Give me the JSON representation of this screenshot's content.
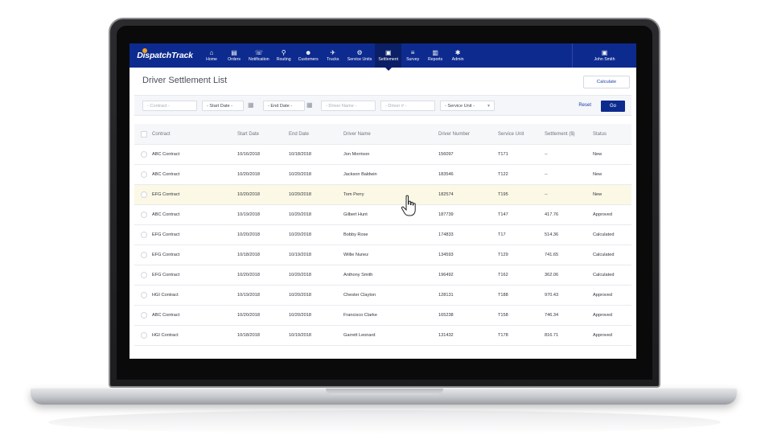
{
  "brand": {
    "name": "DispatchTrack"
  },
  "nav": {
    "items": [
      {
        "label": "Home",
        "icon": "home-icon",
        "glyph": "⌂"
      },
      {
        "label": "Orders",
        "icon": "orders-icon",
        "glyph": "▤"
      },
      {
        "label": "Notification",
        "icon": "notification-icon",
        "glyph": "☏"
      },
      {
        "label": "Routing",
        "icon": "routing-icon",
        "glyph": "⚲"
      },
      {
        "label": "Customers",
        "icon": "customers-icon",
        "glyph": "☻"
      },
      {
        "label": "Trucks",
        "icon": "trucks-icon",
        "glyph": "✈"
      },
      {
        "label": "Service Units",
        "icon": "service-units-icon",
        "glyph": "⚙"
      },
      {
        "label": "Settlement",
        "icon": "settlement-icon",
        "glyph": "▣"
      },
      {
        "label": "Survey",
        "icon": "survey-icon",
        "glyph": "≡"
      },
      {
        "label": "Reports",
        "icon": "reports-icon",
        "glyph": "▥"
      },
      {
        "label": "Admin",
        "icon": "admin-icon",
        "glyph": "✱"
      }
    ],
    "active": "Settlement"
  },
  "user": {
    "name": "John Smith",
    "icon": "user-icon"
  },
  "page": {
    "title": "Driver Settlement List",
    "calculate_label": "Calculate"
  },
  "filters": {
    "contract_placeholder": "- Contract -",
    "start_date_label": "- Start Date -",
    "end_date_label": "- End Date -",
    "driver_name_placeholder": "- Driver Name -",
    "driver_number_placeholder": "- Driver # -",
    "service_unit_label": "- Service Unit -",
    "reset_label": "Reset",
    "go_label": "Go"
  },
  "table": {
    "headers": {
      "contract": "Contract",
      "start_date": "Start Date",
      "end_date": "End Date",
      "driver_name": "Driver Name",
      "driver_number": "Driver Number",
      "service_unit": "Service Unit",
      "settlement": "Settlement ($)",
      "status": "Status"
    },
    "rows": [
      {
        "contract": "ABC Contract",
        "start": "10/16/2018",
        "end": "10/18/2018",
        "driver": "Jon Morrison",
        "number": "156097",
        "unit": "T171",
        "settlement": "--",
        "status": "New"
      },
      {
        "contract": "ABC Contract",
        "start": "10/20/2018",
        "end": "10/20/2018",
        "driver": "Jackson Baldwin",
        "number": "183546",
        "unit": "T122",
        "settlement": "--",
        "status": "New"
      },
      {
        "contract": "EFG Contract",
        "start": "10/20/2018",
        "end": "10/20/2018",
        "driver": "Tom Perry",
        "number": "182574",
        "unit": "T195",
        "settlement": "--",
        "status": "New"
      },
      {
        "contract": "ABC Contract",
        "start": "10/19/2018",
        "end": "10/20/2018",
        "driver": "Gilbert Hunt",
        "number": "187739",
        "unit": "T147",
        "settlement": "417.76",
        "status": "Approved"
      },
      {
        "contract": "EFG Contract",
        "start": "10/20/2018",
        "end": "10/20/2018",
        "driver": "Bobby Rose",
        "number": "174833",
        "unit": "T17",
        "settlement": "514.36",
        "status": "Calculated"
      },
      {
        "contract": "EFG Contract",
        "start": "10/18/2018",
        "end": "10/19/2018",
        "driver": "Willie Nunez",
        "number": "134593",
        "unit": "T129",
        "settlement": "741.65",
        "status": "Calculated"
      },
      {
        "contract": "EFG Contract",
        "start": "10/20/2018",
        "end": "10/20/2018",
        "driver": "Anthony Smith",
        "number": "196492",
        "unit": "T162",
        "settlement": "362.06",
        "status": "Calculated"
      },
      {
        "contract": "HGI Contract",
        "start": "10/19/2018",
        "end": "10/20/2018",
        "driver": "Chester Clayton",
        "number": "128131",
        "unit": "T188",
        "settlement": "970.43",
        "status": "Approved"
      },
      {
        "contract": "ABC Contract",
        "start": "10/20/2018",
        "end": "10/20/2018",
        "driver": "Francisco Clarke",
        "number": "165238",
        "unit": "T158",
        "settlement": "746.34",
        "status": "Approved"
      },
      {
        "contract": "HGI Contract",
        "start": "10/18/2018",
        "end": "10/19/2018",
        "driver": "Garrett Leonard",
        "number": "131432",
        "unit": "T178",
        "settlement": "816.71",
        "status": "Approved"
      }
    ],
    "highlighted_row": 2
  },
  "colors": {
    "nav_bg": "#0d2a8e",
    "accent": "#1a3ea8",
    "highlight_row": "#fbf8e6"
  }
}
